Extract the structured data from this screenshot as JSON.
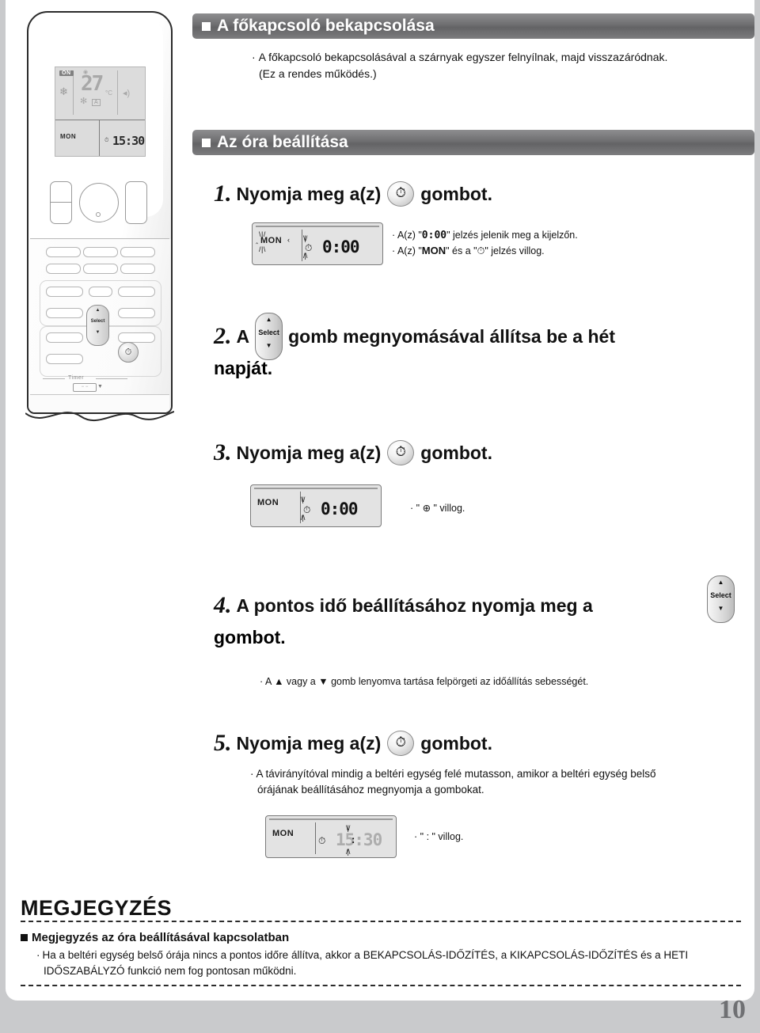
{
  "page": {
    "number": "10",
    "accent_header_color": "#6e6e70",
    "background_color": "#c9cacc"
  },
  "remote": {
    "lcd": {
      "on_badge": "ON",
      "temperature": "27",
      "temp_unit": "C",
      "auto_label": "A",
      "day": "MON",
      "time": "15:30",
      "snowflake_icon": "snowflake-icon",
      "fan_icon": "fan-icon",
      "swing_icon": "swing-icon",
      "clock_icon": "clock-icon"
    },
    "select_button_label": "Select",
    "timer_label": "Timer",
    "clock_button_icon": "clock-icon"
  },
  "sections": [
    {
      "title": "A főkapcsoló bekapcsolása",
      "notes": [
        "A főkapcsoló bekapcsolásával a szárnyak egyszer felnyílnak, majd visszazáródnak.",
        "(Ez a rendes működés.)"
      ]
    },
    {
      "title": "Az óra beállítása"
    }
  ],
  "steps": [
    {
      "number": "1.",
      "text_before": "Nyomja meg a(z)",
      "button": "clock-button",
      "text_after": "gombot.",
      "lcd": {
        "day": "MON",
        "time": "0:00",
        "day_flashing": true,
        "clock_flashing": true
      },
      "bullets": [
        {
          "pre": "A(z) \"",
          "code": "0:00",
          "post": "\" jelzés jelenik meg a kijelzőn."
        },
        {
          "pre": "A(z) \"",
          "code": "MON",
          "mid": "\" és a \"",
          "icon": "clock-icon",
          "post": "\" jelzés villog."
        }
      ]
    },
    {
      "number": "2.",
      "text_before": "A",
      "button": "select-button",
      "text_after": "gomb megnyomásával állítsa be a hét",
      "text_line2": "napját."
    },
    {
      "number": "3.",
      "text_before": "Nyomja meg a(z)",
      "button": "clock-button",
      "text_after": "gombot.",
      "lcd": {
        "day": "MON",
        "time": "0:00",
        "clock_flashing": true
      },
      "bullet": "\" ⊕ \" villog."
    },
    {
      "number": "4.",
      "text_before": "A pontos idő beállításához nyomja meg a",
      "button": "select-button",
      "text_line2": "gombot.",
      "note": "A ▲ vagy a ▼ gomb lenyomva tartása felpörgeti az időállítás sebességét."
    },
    {
      "number": "5.",
      "text_before": "Nyomja meg a(z)",
      "button": "clock-button",
      "text_after": "gombot.",
      "note_lines": [
        "A távirányítóval mindig a beltéri egység felé mutasson, amikor a beltéri egység belső",
        "órájának beállításához megnyomja a gombokat."
      ],
      "lcd": {
        "day": "MON",
        "time": "15:30",
        "colon_flashing": true
      },
      "bullet": "\" : \" villog."
    }
  ],
  "megjegyzes": {
    "title": "MEGJEGYZÉS",
    "subtitle": "Megjegyzés az óra beállításával kapcsolatban",
    "body_lines": [
      "Ha a beltéri egység belső órája nincs a pontos időre állítva, akkor a BEKAPCSOLÁS-IDŐZÍTÉS, a KIKAPCSOLÁS-IDŐZÍTÉS és a HETI",
      "IDŐSZABÁLYZÓ funkció nem fog pontosan működni."
    ]
  }
}
